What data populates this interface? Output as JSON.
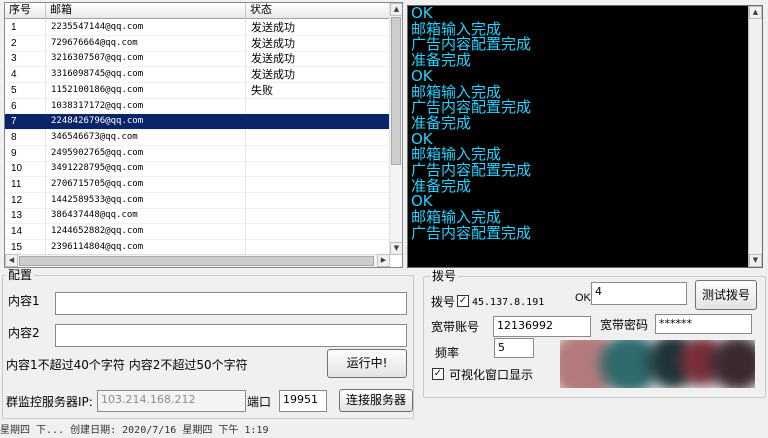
{
  "list": {
    "columns": [
      "序号",
      "邮箱",
      "状态"
    ],
    "rows": [
      {
        "num": "1",
        "email": "2235547144@qq.com",
        "status": "发送成功"
      },
      {
        "num": "2",
        "email": "729676664@qq.com",
        "status": "发送成功"
      },
      {
        "num": "3",
        "email": "3216307507@qq.com",
        "status": "发送成功"
      },
      {
        "num": "4",
        "email": "3316098745@qq.com",
        "status": "发送成功"
      },
      {
        "num": "5",
        "email": "1152100186@qq.com",
        "status": "失败"
      },
      {
        "num": "6",
        "email": "1038317172@qq.com",
        "status": ""
      },
      {
        "num": "7",
        "email": "2248426796@qq.com",
        "status": ""
      },
      {
        "num": "8",
        "email": "346546673@qq.com",
        "status": ""
      },
      {
        "num": "9",
        "email": "2495902765@qq.com",
        "status": ""
      },
      {
        "num": "10",
        "email": "3491228795@qq.com",
        "status": ""
      },
      {
        "num": "11",
        "email": "2706715705@qq.com",
        "status": ""
      },
      {
        "num": "12",
        "email": "1442589533@qq.com",
        "status": ""
      },
      {
        "num": "13",
        "email": "386437448@qq.com",
        "status": ""
      },
      {
        "num": "14",
        "email": "1244652882@qq.com",
        "status": ""
      },
      {
        "num": "15",
        "email": "2396114804@qq.com",
        "status": ""
      }
    ],
    "selected_row": "7"
  },
  "console": {
    "lines": [
      "OK",
      "邮箱输入完成",
      "广告内容配置完成",
      "准备完成",
      "OK",
      "邮箱输入完成",
      "广告内容配置完成",
      "准备完成",
      "OK",
      "邮箱输入完成",
      "广告内容配置完成",
      "准备完成",
      "OK",
      "邮箱输入完成",
      "广告内容配置完成"
    ],
    "text_color": "#22d4ff"
  },
  "config": {
    "title": "配置",
    "content1_label": "内容1",
    "content1_value": "",
    "content2_label": "内容2",
    "content2_value": "",
    "hint": "内容1不超过40个字符 内容2不超过50个字符",
    "run_button": "运行中!",
    "server_label": "群监控服务器IP:",
    "server_ip": "103.214.168.212",
    "port_label": "端口",
    "port_value": "19951",
    "connect_button": "连接服务器"
  },
  "dialup": {
    "title": "拨号",
    "dial_label": "拨号",
    "dial_checked": true,
    "dial_ip": "45.137.8.191",
    "ok_label": "OK",
    "ok_value": "4",
    "test_button": "测试拨号",
    "account_label": "宽带账号",
    "account_value": "12136992",
    "password_label": "宽带密码",
    "password_value": "******",
    "freq_label": "频率",
    "freq_value": "5",
    "visual_label": "可视化窗口显示",
    "visual_checked": true
  },
  "statusbar": {
    "text": "星期四 下... 创建日期: 2020/7/16 星期四 下午 1:19"
  }
}
